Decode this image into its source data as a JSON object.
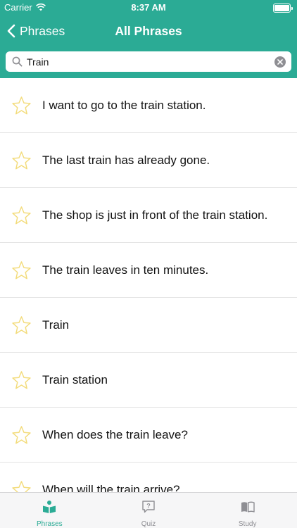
{
  "status_bar": {
    "carrier": "Carrier",
    "time": "8:37 AM"
  },
  "nav": {
    "back_label": "Phrases",
    "title": "All Phrases"
  },
  "search": {
    "value": "Train"
  },
  "phrases": [
    {
      "text": "I want to go to the train station."
    },
    {
      "text": "The last train has already gone."
    },
    {
      "text": "The shop is just in front of the train station."
    },
    {
      "text": "The train leaves in ten minutes."
    },
    {
      "text": "Train"
    },
    {
      "text": "Train station"
    },
    {
      "text": "When does the train leave?"
    },
    {
      "text": "When will the train arrive?"
    }
  ],
  "tabs": [
    {
      "label": "Phrases",
      "icon": "book-person-icon",
      "active": true
    },
    {
      "label": "Quiz",
      "icon": "quiz-icon",
      "active": false
    },
    {
      "label": "Study",
      "icon": "open-book-icon",
      "active": false
    }
  ],
  "colors": {
    "accent": "#2bab95",
    "star_outline": "#f3dc7c",
    "tab_inactive": "#8e8e93"
  }
}
